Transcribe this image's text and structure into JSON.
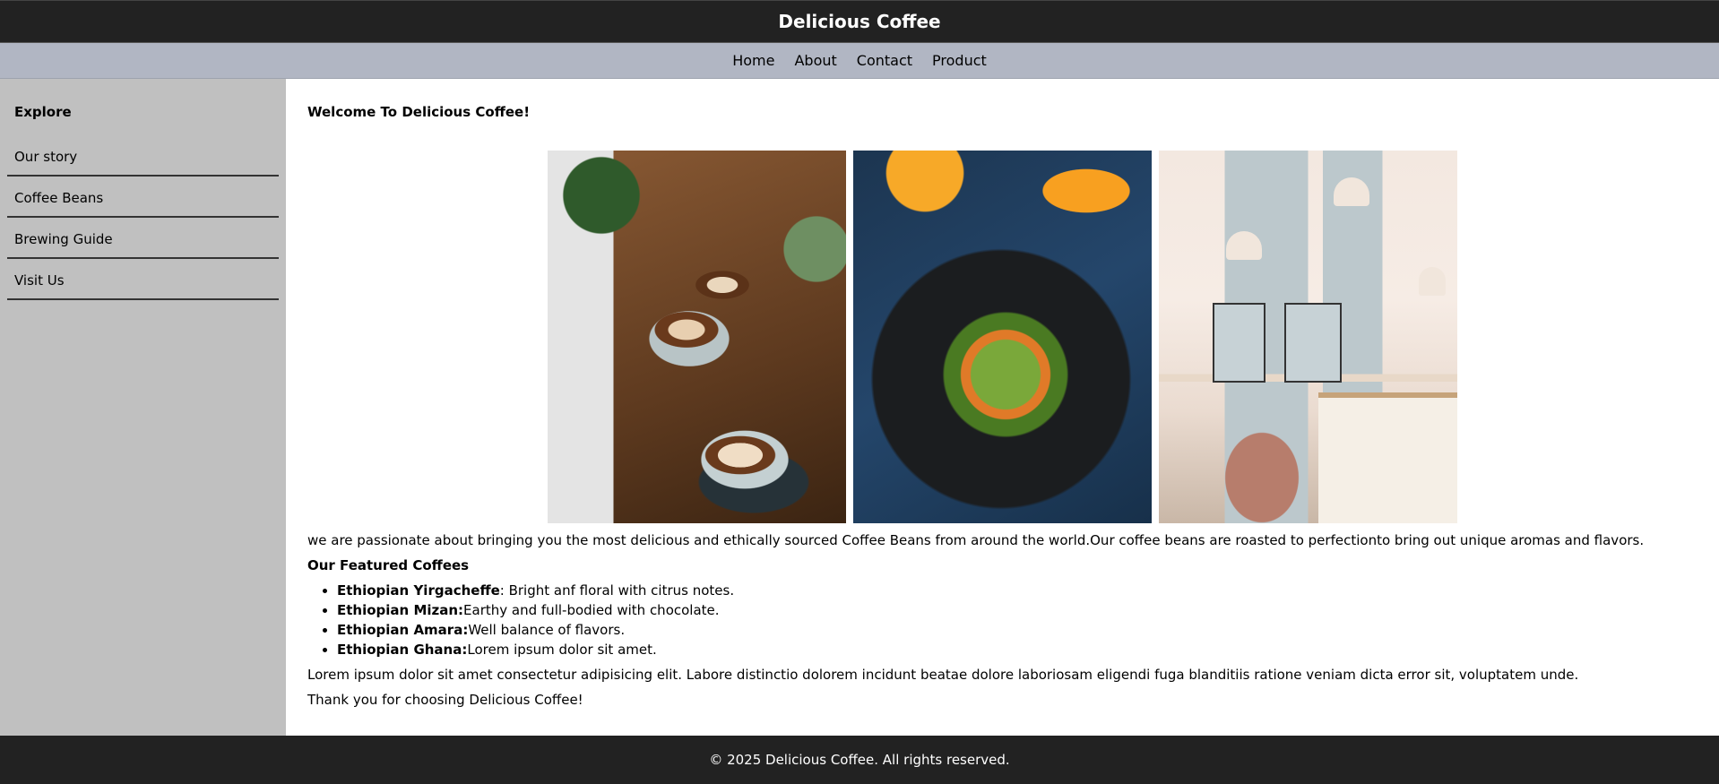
{
  "header": {
    "title": "Delicious Coffee"
  },
  "nav": {
    "items": [
      "Home",
      "About",
      "Contact",
      "Product"
    ]
  },
  "sidebar": {
    "title": "Explore",
    "items": [
      "Our story",
      "Coffee Beans",
      "Brewing Guide",
      "Visit Us"
    ]
  },
  "main": {
    "welcome": "Welcome To Delicious Coffee!",
    "images": [
      "coffee-cups-photo",
      "salad-plate-photo",
      "cafe-interior-photo"
    ],
    "intro": "we are passionate about bringing you the most delicious and ethically sourced Coffee Beans from around the world.Our coffee beans are roasted to perfectionto bring out unique aromas and flavors.",
    "featured_title": "Our Featured Coffees",
    "coffees": [
      {
        "name": "Ethiopian Yirgacheffe",
        "desc": ": Bright anf floral with citrus notes."
      },
      {
        "name": "Ethiopian Mizan:",
        "desc": "Earthy and full-bodied with chocolate."
      },
      {
        "name": "Ethiopian Amara:",
        "desc": "Well balance of flavors."
      },
      {
        "name": "Ethiopian Ghana:",
        "desc": "Lorem ipsum dolor sit amet."
      }
    ],
    "lorem": "Lorem ipsum dolor sit amet consectetur adipisicing elit. Labore distinctio dolorem incidunt beatae dolore laboriosam eligendi fuga blanditiis ratione veniam dicta error sit, voluptatem unde.",
    "thanks": "Thank you for choosing Delicious Coffee!"
  },
  "footer": {
    "text": "© 2025 Delicious Coffee. All rights reserved."
  },
  "colors": {
    "header_bg": "#222222",
    "nav_bg": "#b1b6c3",
    "sidebar_bg": "#c0c0c0"
  }
}
